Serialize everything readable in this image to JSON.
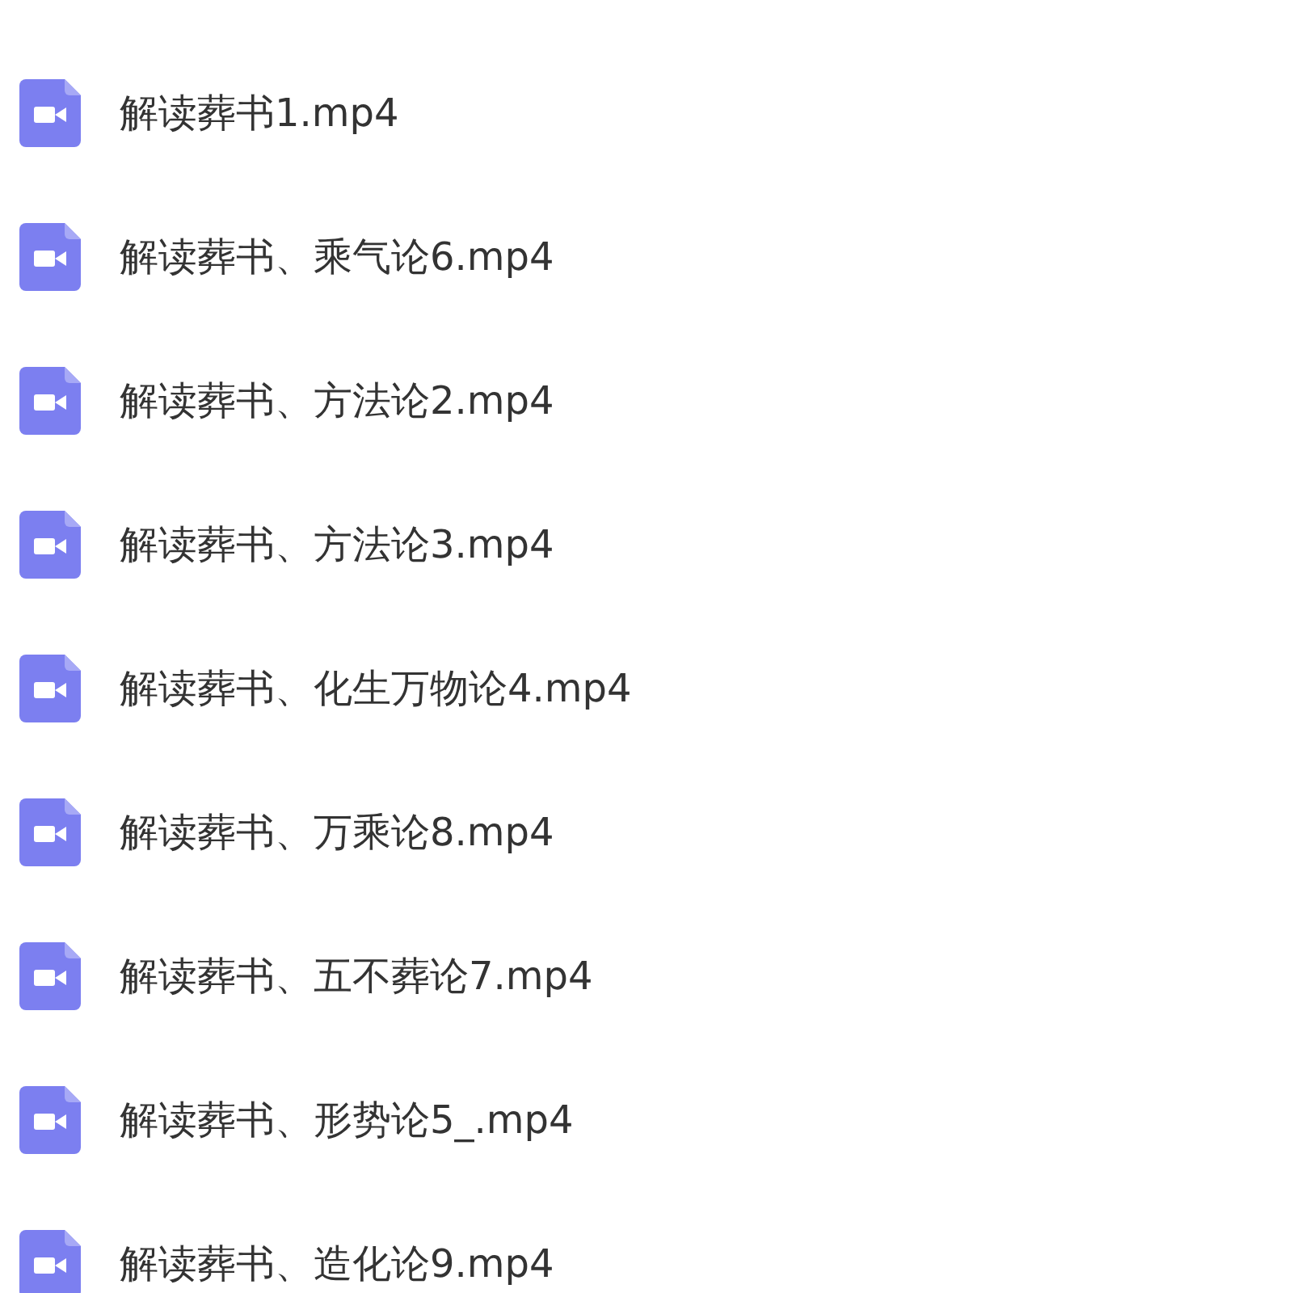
{
  "files": [
    {
      "name": "解读葬书1.mp4"
    },
    {
      "name": "解读葬书、乘气论6.mp4"
    },
    {
      "name": "解读葬书、方法论2.mp4"
    },
    {
      "name": "解读葬书、方法论3.mp4"
    },
    {
      "name": "解读葬书、化生万物论4.mp4"
    },
    {
      "name": "解读葬书、万乘论8.mp4"
    },
    {
      "name": "解读葬书、五不葬论7.mp4"
    },
    {
      "name": "解读葬书、形势论5_.mp4"
    },
    {
      "name": "解读葬书、造化论9.mp4"
    }
  ]
}
